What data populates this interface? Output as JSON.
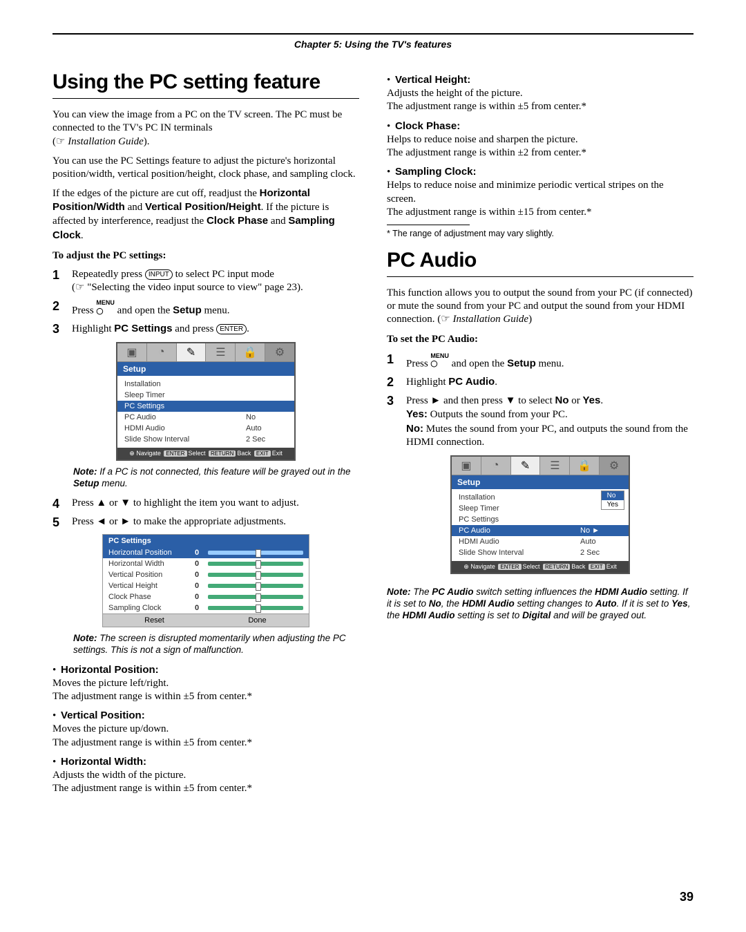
{
  "chapter_header": "Chapter 5: Using the TV's features",
  "page_number": "39",
  "left": {
    "h1": "Using the PC setting feature",
    "p1a": "You can view the image from a PC on the TV screen. The PC must be connected to the TV's PC IN terminals",
    "p1b": "Installation Guide",
    "p2": "You can use the PC Settings feature to adjust the picture's horizontal position/width, vertical position/height, clock phase, and sampling clock.",
    "p3_a": "If the edges of the picture are cut off, readjust the ",
    "p3_b": "Horizontal Position/Width",
    "p3_c": " and ",
    "p3_d": "Vertical Position/Height",
    "p3_e": ". If the picture is affected by interference, readjust the ",
    "p3_f": "Clock Phase",
    "p3_g": " and ",
    "p3_h": "Sampling Clock",
    "p3_i": ".",
    "sub1": "To adjust the PC settings:",
    "s1_a": "Repeatedly press ",
    "s1_b": " to select PC input mode",
    "s1_c": "(☞ \"Selecting the video input source to view\" page 23).",
    "s2_a": "Press ",
    "s2_b": " and open the ",
    "s2_c": "Setup",
    "s2_d": " menu.",
    "s3_a": "Highlight ",
    "s3_b": "PC Settings",
    "s3_c": " and press ",
    "note1_a": "Note:",
    "note1_b": " If a PC is not connected, this feature will be grayed out in the ",
    "note1_c": "Setup",
    "note1_d": " menu.",
    "s4": "Press ▲ or ▼ to highlight the item you want to adjust.",
    "s5": "Press ◄ or ► to make the appropriate adjustments.",
    "note2_a": "Note:",
    "note2_b": " The screen is disrupted momentarily when adjusting the PC settings. This is not a sign of malfunction.",
    "b_hp_t": "Horizontal Position:",
    "b_hp_1": "Moves the picture left/right.",
    "b_hp_2": "The adjustment range is within ±5 from center.*",
    "b_vp_t": "Vertical Position:",
    "b_vp_1": "Moves the picture up/down.",
    "b_vp_2": "The adjustment range is within ±5 from center.*",
    "b_hw_t": "Horizontal Width:",
    "b_hw_1": "Adjusts the width of the picture.",
    "b_hw_2": "The adjustment range is within ±5 from center.*",
    "osd1": {
      "title": "Setup",
      "rows": [
        {
          "k": "Installation",
          "v": ""
        },
        {
          "k": "Sleep Timer",
          "v": ""
        },
        {
          "k": "PC Settings",
          "v": "",
          "sel": true
        },
        {
          "k": "PC Audio",
          "v": "No"
        },
        {
          "k": "HDMI Audio",
          "v": "Auto"
        },
        {
          "k": "Slide Show Interval",
          "v": "2 Sec"
        }
      ],
      "foot_nav": "Navigate",
      "foot_sel": "Select",
      "foot_back": "Back",
      "foot_exit": "Exit",
      "chip_enter": "ENTER",
      "chip_return": "RETURN",
      "chip_exit": "EXIT"
    },
    "pcset": {
      "title": "PC Settings",
      "rows": [
        {
          "k": "Horizontal Position",
          "n": "0",
          "sel": true
        },
        {
          "k": "Horizontal Width",
          "n": "0"
        },
        {
          "k": "Vertical Position",
          "n": "0"
        },
        {
          "k": "Vertical Height",
          "n": "0"
        },
        {
          "k": "Clock Phase",
          "n": "0"
        },
        {
          "k": "Sampling Clock",
          "n": "0"
        }
      ],
      "reset": "Reset",
      "done": "Done"
    }
  },
  "right": {
    "b_vh_t": "Vertical Height:",
    "b_vh_1": "Adjusts the height of the picture.",
    "b_vh_2": "The adjustment range is within ±5 from center.*",
    "b_cp_t": "Clock Phase:",
    "b_cp_1": "Helps to reduce noise and sharpen the picture.",
    "b_cp_2": "The adjustment range is within ±2 from center.*",
    "b_sc_t": "Sampling Clock:",
    "b_sc_1": "Helps to reduce noise and minimize periodic vertical stripes on the screen.",
    "b_sc_2": "The adjustment range is within ±15 from center.*",
    "fn": "*    The range of adjustment may vary slightly.",
    "h1": "PC Audio",
    "p1_a": "This function allows you to output the sound from your PC (if connected) or mute the sound from your PC and output the sound from your HDMI connection. (☞ ",
    "p1_b": "Installation Guide",
    "p1_c": ")",
    "sub": "To set the PC Audio:",
    "s1_a": "Press ",
    "s1_b": " and open the ",
    "s1_c": "Setup",
    "s1_d": " menu.",
    "s2_a": "Highlight ",
    "s2_b": "PC Audio",
    "s2_c": ".",
    "s3_a": "Press ► and then press ▼ to select ",
    "s3_b": "No",
    "s3_c": " or ",
    "s3_d": "Yes",
    "s3_e": ".",
    "s3_yes": "Yes:",
    "s3_yesb": " Outputs the sound from your PC.",
    "s3_no": "No:",
    "s3_nob": " Mutes the sound from your PC, and outputs the sound from the HDMI connection.",
    "osd2": {
      "title": "Setup",
      "rows": [
        {
          "k": "Installation",
          "v": ""
        },
        {
          "k": "Sleep Timer",
          "v": ""
        },
        {
          "k": "PC Settings",
          "v": ""
        },
        {
          "k": "PC Audio",
          "v": "No ►",
          "sel": true
        },
        {
          "k": "HDMI Audio",
          "v": "Auto"
        },
        {
          "k": "Slide Show Interval",
          "v": "2 Sec"
        }
      ],
      "popup": [
        "No",
        "Yes"
      ],
      "foot_nav": "Navigate",
      "foot_sel": "Select",
      "foot_back": "Back",
      "foot_exit": "Exit",
      "chip_enter": "ENTER",
      "chip_return": "RETURN",
      "chip_exit": "EXIT"
    },
    "note_a": "Note:",
    "note_b": " The ",
    "note_c": "PC Audio",
    "note_d": " switch setting influences the ",
    "note_e": "HDMI Audio",
    "note_f": " setting. If it is set to ",
    "note_g": "No",
    "note_h": ", the ",
    "note_i": "HDMI Audio",
    "note_j": " setting changes to ",
    "note_k": "Auto",
    "note_l": ". If it is set to ",
    "note_m": "Yes",
    "note_n": ", the ",
    "note_o": "HDMI Audio",
    "note_p": " setting is set to ",
    "note_q": "Digital",
    "note_r": " and will be grayed out."
  }
}
